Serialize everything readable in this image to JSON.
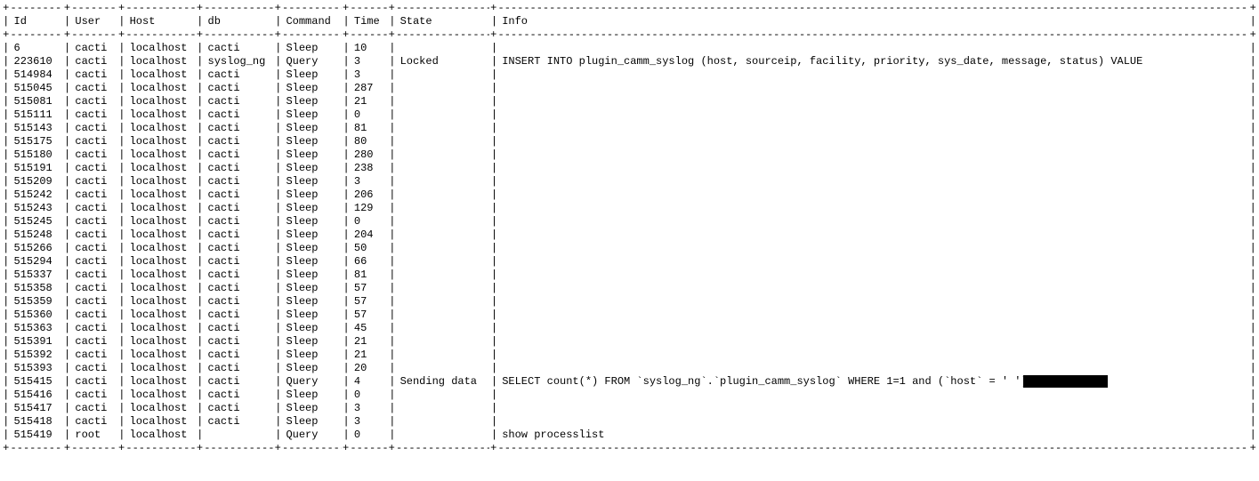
{
  "headers": {
    "id": "Id",
    "user": "User",
    "host": "Host",
    "db": "db",
    "command": "Command",
    "time": "Time",
    "state": "State",
    "info": "Info"
  },
  "rows": [
    {
      "id": "6",
      "user": "cacti",
      "host": "localhost",
      "db": "cacti",
      "command": "Sleep",
      "time": "10",
      "state": "",
      "info": ""
    },
    {
      "id": "223610",
      "user": "cacti",
      "host": "localhost",
      "db": "syslog_ng",
      "command": "Query",
      "time": "3",
      "state": "Locked",
      "info": "INSERT INTO plugin_camm_syslog (host, sourceip, facility, priority, sys_date, message, status) VALUE"
    },
    {
      "id": "514984",
      "user": "cacti",
      "host": "localhost",
      "db": "cacti",
      "command": "Sleep",
      "time": "3",
      "state": "",
      "info": ""
    },
    {
      "id": "515045",
      "user": "cacti",
      "host": "localhost",
      "db": "cacti",
      "command": "Sleep",
      "time": "287",
      "state": "",
      "info": ""
    },
    {
      "id": "515081",
      "user": "cacti",
      "host": "localhost",
      "db": "cacti",
      "command": "Sleep",
      "time": "21",
      "state": "",
      "info": ""
    },
    {
      "id": "515111",
      "user": "cacti",
      "host": "localhost",
      "db": "cacti",
      "command": "Sleep",
      "time": "0",
      "state": "",
      "info": ""
    },
    {
      "id": "515143",
      "user": "cacti",
      "host": "localhost",
      "db": "cacti",
      "command": "Sleep",
      "time": "81",
      "state": "",
      "info": ""
    },
    {
      "id": "515175",
      "user": "cacti",
      "host": "localhost",
      "db": "cacti",
      "command": "Sleep",
      "time": "80",
      "state": "",
      "info": ""
    },
    {
      "id": "515180",
      "user": "cacti",
      "host": "localhost",
      "db": "cacti",
      "command": "Sleep",
      "time": "280",
      "state": "",
      "info": ""
    },
    {
      "id": "515191",
      "user": "cacti",
      "host": "localhost",
      "db": "cacti",
      "command": "Sleep",
      "time": "238",
      "state": "",
      "info": ""
    },
    {
      "id": "515209",
      "user": "cacti",
      "host": "localhost",
      "db": "cacti",
      "command": "Sleep",
      "time": "3",
      "state": "",
      "info": ""
    },
    {
      "id": "515242",
      "user": "cacti",
      "host": "localhost",
      "db": "cacti",
      "command": "Sleep",
      "time": "206",
      "state": "",
      "info": ""
    },
    {
      "id": "515243",
      "user": "cacti",
      "host": "localhost",
      "db": "cacti",
      "command": "Sleep",
      "time": "129",
      "state": "",
      "info": ""
    },
    {
      "id": "515245",
      "user": "cacti",
      "host": "localhost",
      "db": "cacti",
      "command": "Sleep",
      "time": "0",
      "state": "",
      "info": ""
    },
    {
      "id": "515248",
      "user": "cacti",
      "host": "localhost",
      "db": "cacti",
      "command": "Sleep",
      "time": "204",
      "state": "",
      "info": ""
    },
    {
      "id": "515266",
      "user": "cacti",
      "host": "localhost",
      "db": "cacti",
      "command": "Sleep",
      "time": "50",
      "state": "",
      "info": ""
    },
    {
      "id": "515294",
      "user": "cacti",
      "host": "localhost",
      "db": "cacti",
      "command": "Sleep",
      "time": "66",
      "state": "",
      "info": ""
    },
    {
      "id": "515337",
      "user": "cacti",
      "host": "localhost",
      "db": "cacti",
      "command": "Sleep",
      "time": "81",
      "state": "",
      "info": ""
    },
    {
      "id": "515358",
      "user": "cacti",
      "host": "localhost",
      "db": "cacti",
      "command": "Sleep",
      "time": "57",
      "state": "",
      "info": ""
    },
    {
      "id": "515359",
      "user": "cacti",
      "host": "localhost",
      "db": "cacti",
      "command": "Sleep",
      "time": "57",
      "state": "",
      "info": ""
    },
    {
      "id": "515360",
      "user": "cacti",
      "host": "localhost",
      "db": "cacti",
      "command": "Sleep",
      "time": "57",
      "state": "",
      "info": ""
    },
    {
      "id": "515363",
      "user": "cacti",
      "host": "localhost",
      "db": "cacti",
      "command": "Sleep",
      "time": "45",
      "state": "",
      "info": ""
    },
    {
      "id": "515391",
      "user": "cacti",
      "host": "localhost",
      "db": "cacti",
      "command": "Sleep",
      "time": "21",
      "state": "",
      "info": ""
    },
    {
      "id": "515392",
      "user": "cacti",
      "host": "localhost",
      "db": "cacti",
      "command": "Sleep",
      "time": "21",
      "state": "",
      "info": ""
    },
    {
      "id": "515393",
      "user": "cacti",
      "host": "localhost",
      "db": "cacti",
      "command": "Sleep",
      "time": "20",
      "state": "",
      "info": ""
    },
    {
      "id": "515415",
      "user": "cacti",
      "host": "localhost",
      "db": "cacti",
      "command": "Query",
      "time": "4",
      "state": "Sending data",
      "info": "SELECT count(*) FROM `syslog_ng`.`plugin_camm_syslog` WHERE 1=1  and  (`host` = '              ')",
      "redact": true
    },
    {
      "id": "515416",
      "user": "cacti",
      "host": "localhost",
      "db": "cacti",
      "command": "Sleep",
      "time": "0",
      "state": "",
      "info": ""
    },
    {
      "id": "515417",
      "user": "cacti",
      "host": "localhost",
      "db": "cacti",
      "command": "Sleep",
      "time": "3",
      "state": "",
      "info": ""
    },
    {
      "id": "515418",
      "user": "cacti",
      "host": "localhost",
      "db": "cacti",
      "command": "Sleep",
      "time": "3",
      "state": "",
      "info": ""
    },
    {
      "id": "515419",
      "user": "root",
      "host": "localhost",
      "db": "",
      "command": "Query",
      "time": "0",
      "state": "",
      "info": "show processlist"
    }
  ]
}
